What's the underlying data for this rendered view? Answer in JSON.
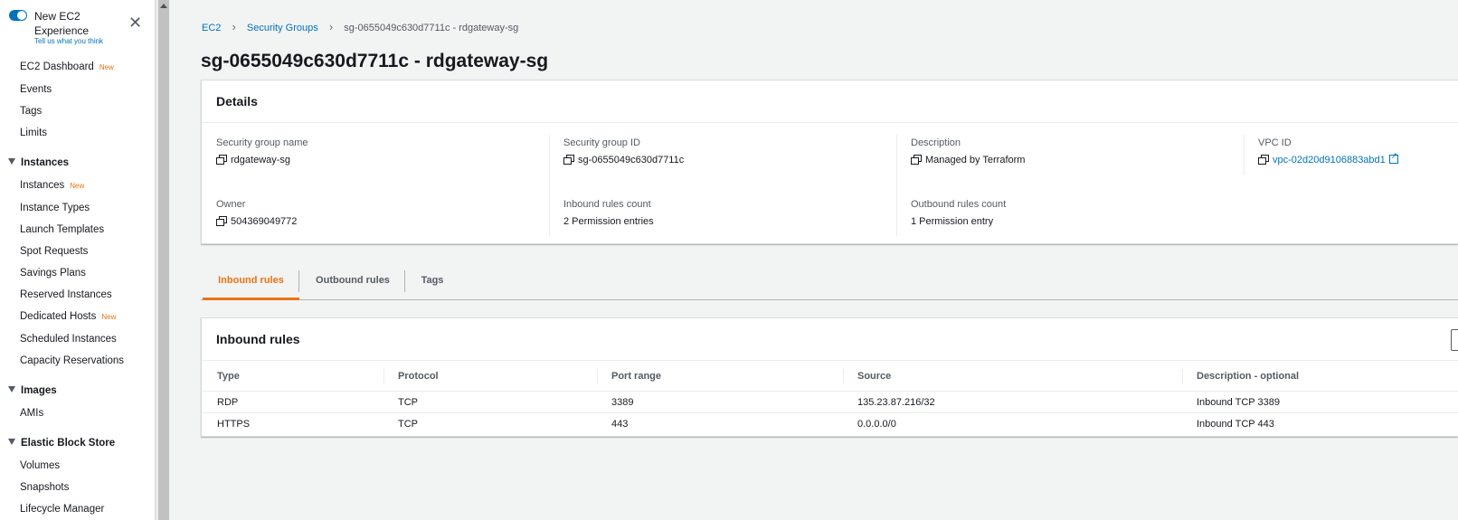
{
  "sidebar": {
    "toggle_label": "New EC2 Experience",
    "tell_us": "Tell us what you think",
    "items_top": [
      {
        "label": "EC2 Dashboard",
        "badge": "New"
      },
      {
        "label": "Events",
        "badge": ""
      },
      {
        "label": "Tags",
        "badge": ""
      },
      {
        "label": "Limits",
        "badge": ""
      }
    ],
    "section_instances": "Instances",
    "items_instances": [
      {
        "label": "Instances",
        "badge": "New"
      },
      {
        "label": "Instance Types",
        "badge": ""
      },
      {
        "label": "Launch Templates",
        "badge": ""
      },
      {
        "label": "Spot Requests",
        "badge": ""
      },
      {
        "label": "Savings Plans",
        "badge": ""
      },
      {
        "label": "Reserved Instances",
        "badge": ""
      },
      {
        "label": "Dedicated Hosts",
        "badge": "New"
      },
      {
        "label": "Scheduled Instances",
        "badge": ""
      },
      {
        "label": "Capacity Reservations",
        "badge": ""
      }
    ],
    "section_images": "Images",
    "items_images": [
      {
        "label": "AMIs",
        "badge": ""
      }
    ],
    "section_ebs": "Elastic Block Store",
    "items_ebs": [
      {
        "label": "Volumes",
        "badge": ""
      },
      {
        "label": "Snapshots",
        "badge": ""
      },
      {
        "label": "Lifecycle Manager",
        "badge": ""
      }
    ]
  },
  "breadcrumb": {
    "root": "EC2",
    "parent": "Security Groups",
    "current": "sg-0655049c630d7711c - rdgateway-sg"
  },
  "page_title": "sg-0655049c630d7711c - rdgateway-sg",
  "details": {
    "header": "Details",
    "sg_name_label": "Security group name",
    "sg_name_value": "rdgateway-sg",
    "sg_id_label": "Security group ID",
    "sg_id_value": "sg-0655049c630d7711c",
    "description_label": "Description",
    "description_value": "Managed by Terraform",
    "vpc_label": "VPC ID",
    "vpc_value": "vpc-02d20d9106883abd1",
    "owner_label": "Owner",
    "owner_value": "504369049772",
    "inbound_count_label": "Inbound rules count",
    "inbound_count_value": "2 Permission entries",
    "outbound_count_label": "Outbound rules count",
    "outbound_count_value": "1 Permission entry"
  },
  "tabs": {
    "inbound": "Inbound rules",
    "outbound": "Outbound rules",
    "tags": "Tags"
  },
  "rules": {
    "header": "Inbound rules",
    "columns": [
      "Type",
      "Protocol",
      "Port range",
      "Source",
      "Description - optional"
    ],
    "rows": [
      [
        "RDP",
        "TCP",
        "3389",
        "135.23.87.216/32",
        "Inbound TCP 3389"
      ],
      [
        "HTTPS",
        "TCP",
        "443",
        "0.0.0.0/0",
        "Inbound TCP 443"
      ]
    ]
  },
  "colors": {
    "link": "#0073bb",
    "accent": "#ec7211",
    "text": "#16191f",
    "muted": "#545b64",
    "background": "#f2f3f3"
  }
}
